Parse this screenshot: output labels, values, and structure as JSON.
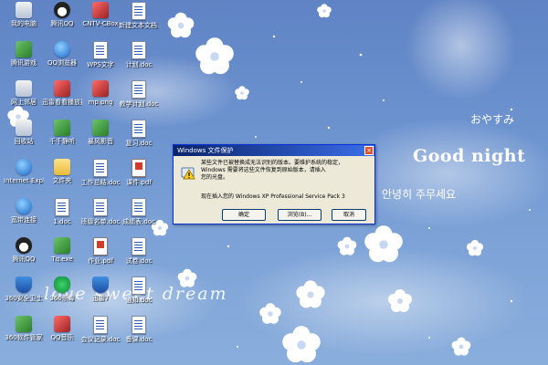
{
  "wallpaper": {
    "goodnight": "Good night",
    "oyasumi": "おやすみ",
    "korean": "안녕히 주무세요",
    "dream": "love sweet dream"
  },
  "desktop_icons": [
    {
      "label": "我的电脑",
      "icon": "generic"
    },
    {
      "label": "腾讯QQ",
      "icon": "penguin"
    },
    {
      "label": "CNTV-CBox",
      "icon": "media"
    },
    {
      "label": "新建文本文档.doc",
      "icon": "doc"
    },
    {
      "label": "腾讯游戏",
      "icon": "app"
    },
    {
      "label": "QQ浏览器",
      "icon": "globe"
    },
    {
      "label": "WPS文字",
      "icon": "doc"
    },
    {
      "label": "计划.doc",
      "icon": "doc"
    },
    {
      "label": "网上邻居",
      "icon": "generic"
    },
    {
      "label": "迅雷看看播放器",
      "icon": "media"
    },
    {
      "label": "mp.png",
      "icon": "media"
    },
    {
      "label": "教学计划.doc",
      "icon": "doc"
    },
    {
      "label": "回收站",
      "icon": "generic"
    },
    {
      "label": "千千静听",
      "icon": "app"
    },
    {
      "label": "暴风影音",
      "icon": "app"
    },
    {
      "label": "复习.doc",
      "icon": "doc"
    },
    {
      "label": "Internet Explorer",
      "icon": "globe"
    },
    {
      "label": "文件夹",
      "icon": "folder"
    },
    {
      "label": "工作总结.doc",
      "icon": "doc"
    },
    {
      "label": "课件.pdf",
      "icon": "pdf"
    },
    {
      "label": "宽带连接",
      "icon": "globe"
    },
    {
      "label": "1.doc",
      "icon": "doc"
    },
    {
      "label": "班级名单.doc",
      "icon": "doc"
    },
    {
      "label": "成绩表.doc",
      "icon": "doc"
    },
    {
      "label": "腾讯QQ",
      "icon": "penguin"
    },
    {
      "label": "Tq.exe",
      "icon": "app"
    },
    {
      "label": "作业.pdf",
      "icon": "pdf"
    },
    {
      "label": "试卷.doc",
      "icon": "doc"
    },
    {
      "label": "360安全卫士",
      "icon": "shield"
    },
    {
      "label": "360杀毒",
      "icon": "butterfly"
    },
    {
      "label": "迅雷7",
      "icon": "shield"
    },
    {
      "label": "通知.doc",
      "icon": "doc"
    },
    {
      "label": "360软件管家",
      "icon": "app"
    },
    {
      "label": "QQ音乐",
      "icon": "media"
    },
    {
      "label": "会议记录.doc",
      "icon": "doc"
    },
    {
      "label": "备课.doc",
      "icon": "doc"
    }
  ],
  "dialog": {
    "title": "Windows 文件保护",
    "close_glyph": "×",
    "message_line1": "某些文件已被替换成无法识别的版本。要维护系统的稳定，",
    "message_line2": "Windows 需要将这些文件恢复到原始版本，请插入",
    "message_line3": "您的光盘。",
    "version_text": "现在插入您的 Windows XP Professional Service Pack 3",
    "ok_label": "确定",
    "browse_label": "浏览(B)...",
    "cancel_label": "取消"
  }
}
